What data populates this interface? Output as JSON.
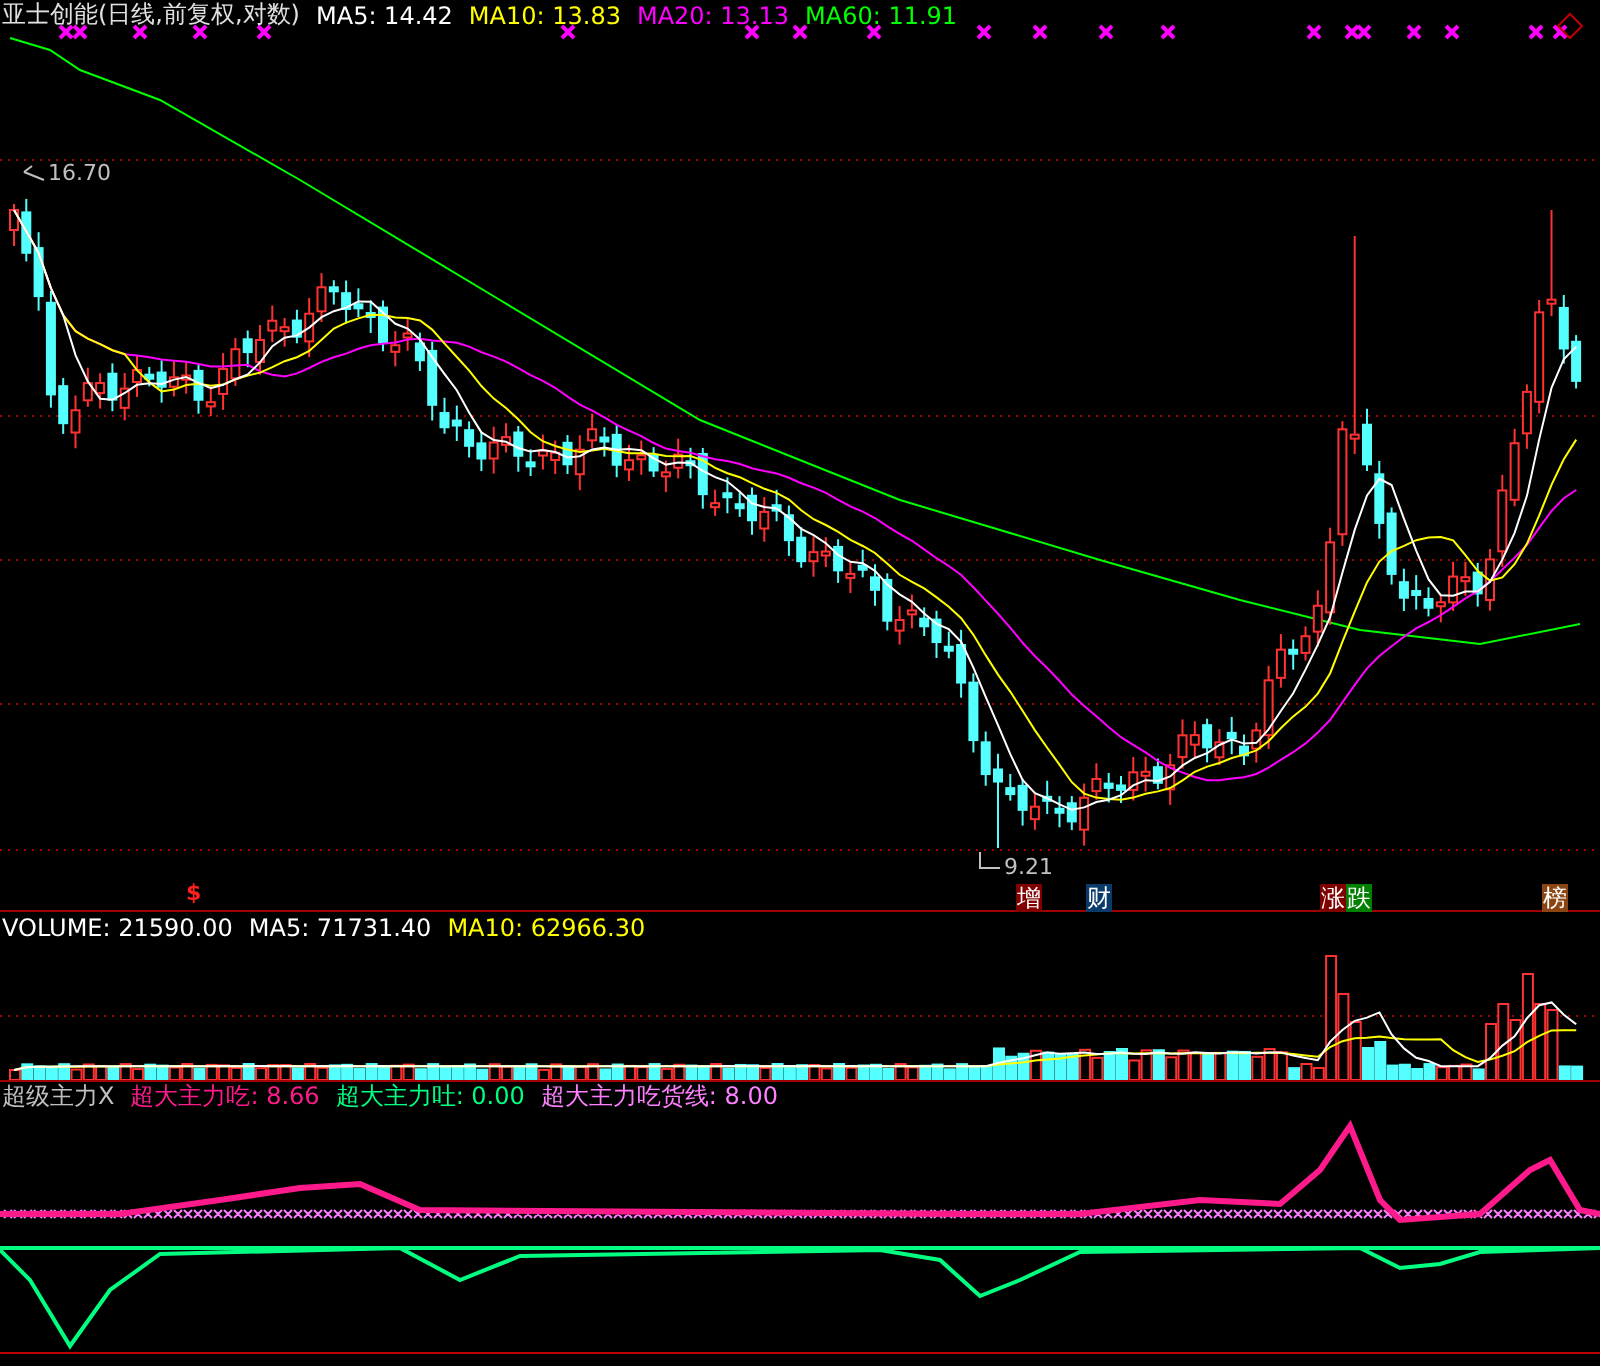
{
  "title": {
    "stock": "亚士创能(日线,前复权,对数)",
    "averages": [
      {
        "label": "MA5: 14.42",
        "color": "#ffffff"
      },
      {
        "label": "MA10: 13.83",
        "color": "#ffff00"
      },
      {
        "label": "MA20: 13.13",
        "color": "#ff00ff"
      },
      {
        "label": "MA60: 11.91",
        "color": "#00ff00"
      }
    ]
  },
  "price_chart": {
    "high_label": "16.70",
    "low_label": "9.21",
    "signal_mark": "$",
    "event_tags": [
      {
        "text": "增",
        "color": "#800000"
      },
      {
        "text": "财",
        "color": "#0a3a6a"
      },
      {
        "text": "涨",
        "color": "#800000"
      },
      {
        "text": "跌",
        "color": "#008000"
      },
      {
        "text": "榜",
        "color": "#8b4513"
      }
    ]
  },
  "volume": {
    "readings": [
      {
        "label": "VOLUME: 21590.00",
        "color": "#ffffff"
      },
      {
        "label": "MA5: 71731.40",
        "color": "#ffffff"
      },
      {
        "label": "MA10: 62966.30",
        "color": "#ffff00"
      }
    ]
  },
  "indicator": {
    "readings": [
      {
        "label": "超级主力X",
        "color": "#c0c0c0"
      },
      {
        "label": "超大主力吃: 8.66",
        "color": "#ff1a8c"
      },
      {
        "label": "超大主力吐: 0.00",
        "color": "#00ff80"
      },
      {
        "label": "超大主力吃货线: 8.00",
        "color": "#ff80ff"
      }
    ]
  }
}
